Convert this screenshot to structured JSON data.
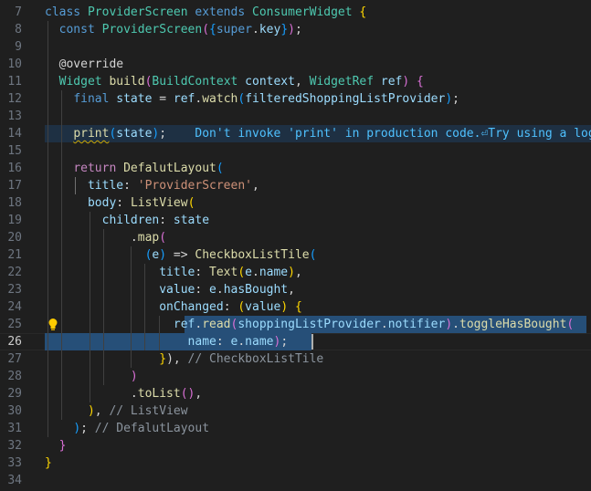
{
  "editor": {
    "lines": [
      {
        "num": "7",
        "tokens": [
          [
            "kw",
            "class"
          ],
          [
            "pu",
            " "
          ],
          [
            "ty",
            "ProviderScreen"
          ],
          [
            "pu",
            " "
          ],
          [
            "kw",
            "extends"
          ],
          [
            "pu",
            " "
          ],
          [
            "ty",
            "ConsumerWidget"
          ],
          [
            "pu",
            " "
          ],
          [
            "b1",
            "{"
          ]
        ]
      },
      {
        "num": "8",
        "tokens": [
          [
            "pu",
            "  "
          ],
          [
            "kw",
            "const"
          ],
          [
            "pu",
            " "
          ],
          [
            "ty",
            "ProviderScreen"
          ],
          [
            "b2",
            "("
          ],
          [
            "b3",
            "{"
          ],
          [
            "kw",
            "super"
          ],
          [
            "pu",
            "."
          ],
          [
            "vr",
            "key"
          ],
          [
            "b3",
            "}"
          ],
          [
            "b2",
            ")"
          ],
          [
            "pu",
            ";"
          ]
        ]
      },
      {
        "num": "9",
        "tokens": []
      },
      {
        "num": "10",
        "tokens": [
          [
            "pu",
            "  "
          ],
          [
            "pu",
            "@override"
          ]
        ]
      },
      {
        "num": "11",
        "tokens": [
          [
            "pu",
            "  "
          ],
          [
            "ty",
            "Widget"
          ],
          [
            "pu",
            " "
          ],
          [
            "fn",
            "build"
          ],
          [
            "b2",
            "("
          ],
          [
            "ty",
            "BuildContext"
          ],
          [
            "pu",
            " "
          ],
          [
            "vr",
            "context"
          ],
          [
            "pu",
            ", "
          ],
          [
            "ty",
            "WidgetRef"
          ],
          [
            "pu",
            " "
          ],
          [
            "vr",
            "ref"
          ],
          [
            "b2",
            ")"
          ],
          [
            "pu",
            " "
          ],
          [
            "b2",
            "{"
          ]
        ]
      },
      {
        "num": "12",
        "tokens": [
          [
            "pu",
            "    "
          ],
          [
            "kw",
            "final"
          ],
          [
            "pu",
            " "
          ],
          [
            "vr",
            "state"
          ],
          [
            "pu",
            " = "
          ],
          [
            "vr",
            "ref"
          ],
          [
            "pu",
            "."
          ],
          [
            "fn",
            "watch"
          ],
          [
            "b3",
            "("
          ],
          [
            "vr",
            "filteredShoppingListProvider"
          ],
          [
            "b3",
            ")"
          ],
          [
            "pu",
            ";"
          ]
        ]
      },
      {
        "num": "13",
        "tokens": []
      },
      {
        "num": "14",
        "tokens": [
          [
            "pu",
            "    "
          ],
          [
            "fn squig",
            "print"
          ],
          [
            "b3",
            "("
          ],
          [
            "vr",
            "state"
          ],
          [
            "b3",
            ")"
          ],
          [
            "pu",
            ";"
          ]
        ]
      },
      {
        "num": "15",
        "tokens": []
      },
      {
        "num": "16",
        "tokens": [
          [
            "pu",
            "    "
          ],
          [
            "kw2",
            "return"
          ],
          [
            "pu",
            " "
          ],
          [
            "fn",
            "DefalutLayout"
          ],
          [
            "b3",
            "("
          ]
        ]
      },
      {
        "num": "17",
        "tokens": [
          [
            "pu",
            "      "
          ],
          [
            "vr",
            "title"
          ],
          [
            "pu",
            ": "
          ],
          [
            "str",
            "'ProviderScreen'"
          ],
          [
            "pu",
            ","
          ]
        ]
      },
      {
        "num": "18",
        "tokens": [
          [
            "pu",
            "      "
          ],
          [
            "vr",
            "body"
          ],
          [
            "pu",
            ": "
          ],
          [
            "fn",
            "ListView"
          ],
          [
            "b1",
            "("
          ]
        ]
      },
      {
        "num": "19",
        "tokens": [
          [
            "pu",
            "        "
          ],
          [
            "vr",
            "children"
          ],
          [
            "pu",
            ": "
          ],
          [
            "vr",
            "state"
          ]
        ]
      },
      {
        "num": "20",
        "tokens": [
          [
            "pu",
            "            "
          ],
          [
            "pu",
            "."
          ],
          [
            "fn",
            "map"
          ],
          [
            "b2",
            "("
          ]
        ]
      },
      {
        "num": "21",
        "tokens": [
          [
            "pu",
            "              "
          ],
          [
            "b3",
            "("
          ],
          [
            "vr",
            "e"
          ],
          [
            "b3",
            ")"
          ],
          [
            "pu",
            " => "
          ],
          [
            "fn",
            "CheckboxListTile"
          ],
          [
            "b3",
            "("
          ]
        ]
      },
      {
        "num": "22",
        "tokens": [
          [
            "pu",
            "                "
          ],
          [
            "vr",
            "title"
          ],
          [
            "pu",
            ": "
          ],
          [
            "fn",
            "Text"
          ],
          [
            "b1",
            "("
          ],
          [
            "vr",
            "e"
          ],
          [
            "pu",
            "."
          ],
          [
            "vr",
            "name"
          ],
          [
            "b1",
            ")"
          ],
          [
            "pu",
            ","
          ]
        ]
      },
      {
        "num": "23",
        "tokens": [
          [
            "pu",
            "                "
          ],
          [
            "vr",
            "value"
          ],
          [
            "pu",
            ": "
          ],
          [
            "vr",
            "e"
          ],
          [
            "pu",
            "."
          ],
          [
            "vr",
            "hasBought"
          ],
          [
            "pu",
            ","
          ]
        ]
      },
      {
        "num": "24",
        "tokens": [
          [
            "pu",
            "                "
          ],
          [
            "vr",
            "onChanged"
          ],
          [
            "pu",
            ": "
          ],
          [
            "b1",
            "("
          ],
          [
            "vr",
            "value"
          ],
          [
            "b1",
            ")"
          ],
          [
            "pu",
            " "
          ],
          [
            "b1",
            "{"
          ]
        ]
      },
      {
        "num": "25",
        "tokens": [
          [
            "pu",
            "                  "
          ],
          [
            "vr",
            "ref"
          ],
          [
            "pu",
            "."
          ],
          [
            "fn",
            "read"
          ],
          [
            "b2",
            "("
          ],
          [
            "vr",
            "shoppingListProvider"
          ],
          [
            "pu",
            "."
          ],
          [
            "vr",
            "notifier"
          ],
          [
            "b2",
            ")"
          ],
          [
            "pu",
            "."
          ],
          [
            "fn",
            "toggleHasBought"
          ],
          [
            "b2",
            "("
          ]
        ]
      },
      {
        "num": "26",
        "tokens": [
          [
            "pu",
            "                    "
          ],
          [
            "vr",
            "name"
          ],
          [
            "pu",
            ": "
          ],
          [
            "vr",
            "e"
          ],
          [
            "pu",
            "."
          ],
          [
            "vr",
            "name"
          ],
          [
            "b2",
            ")"
          ],
          [
            "pu",
            ";"
          ]
        ]
      },
      {
        "num": "27",
        "tokens": [
          [
            "pu",
            "                "
          ],
          [
            "b1",
            "}"
          ],
          [
            "pu",
            "), "
          ],
          [
            "cmt",
            "// CheckboxListTile"
          ]
        ]
      },
      {
        "num": "28",
        "tokens": [
          [
            "pu",
            "            "
          ],
          [
            "b2",
            ")"
          ]
        ]
      },
      {
        "num": "29",
        "tokens": [
          [
            "pu",
            "            "
          ],
          [
            "pu",
            "."
          ],
          [
            "fn",
            "toList"
          ],
          [
            "b2",
            "()"
          ],
          [
            "pu",
            ","
          ]
        ]
      },
      {
        "num": "30",
        "tokens": [
          [
            "pu",
            "      "
          ],
          [
            "b1",
            ")"
          ],
          [
            "pu",
            ", "
          ],
          [
            "cmt",
            "// ListView"
          ]
        ]
      },
      {
        "num": "31",
        "tokens": [
          [
            "pu",
            "    "
          ],
          [
            "b3",
            ")"
          ],
          [
            "pu",
            "; "
          ],
          [
            "cmt",
            "// DefalutLayout"
          ]
        ]
      },
      {
        "num": "32",
        "tokens": [
          [
            "pu",
            "  "
          ],
          [
            "b2",
            "}"
          ]
        ]
      },
      {
        "num": "33",
        "tokens": [
          [
            "b1",
            "}"
          ]
        ]
      },
      {
        "num": "34",
        "tokens": []
      }
    ],
    "warning_text": "Don't invoke 'print' in production code.⏎Try using a logg",
    "active_line": "26",
    "colors": {
      "background": "#1f1f1f",
      "selection": "#264f78",
      "keyword": "#569cd6",
      "type": "#4ec9b0",
      "function": "#dcdcaa",
      "variable": "#9cdcfe",
      "string": "#ce9178",
      "warning": "#4fc1ff"
    },
    "icons": {
      "lightbulb": "lightbulb-icon"
    }
  }
}
